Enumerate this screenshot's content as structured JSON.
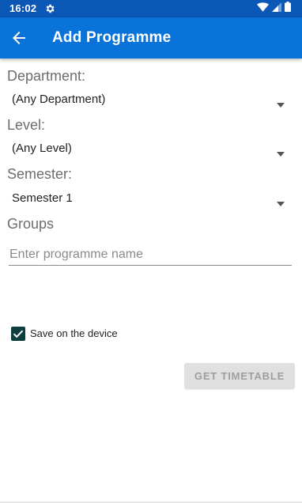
{
  "status_bar": {
    "time": "16:02",
    "icons": [
      "settings-icon",
      "wifi-icon",
      "signal-icon",
      "battery-icon"
    ]
  },
  "app_bar": {
    "title": "Add Programme",
    "color": "#0a73d9",
    "status_color": "#0a57b5"
  },
  "form": {
    "department": {
      "label": "Department:",
      "value": "(Any Department)"
    },
    "level": {
      "label": "Level:",
      "value": "(Any Level)"
    },
    "semester": {
      "label": "Semester:",
      "value": "Semester 1"
    },
    "groups": {
      "label": "Groups",
      "input_value": "",
      "placeholder": "Enter programme name"
    },
    "save_on_device": {
      "label": "Save on the device",
      "checked": true,
      "color": "#0c3f3d"
    },
    "get_timetable_label": "GET TIMETABLE"
  }
}
